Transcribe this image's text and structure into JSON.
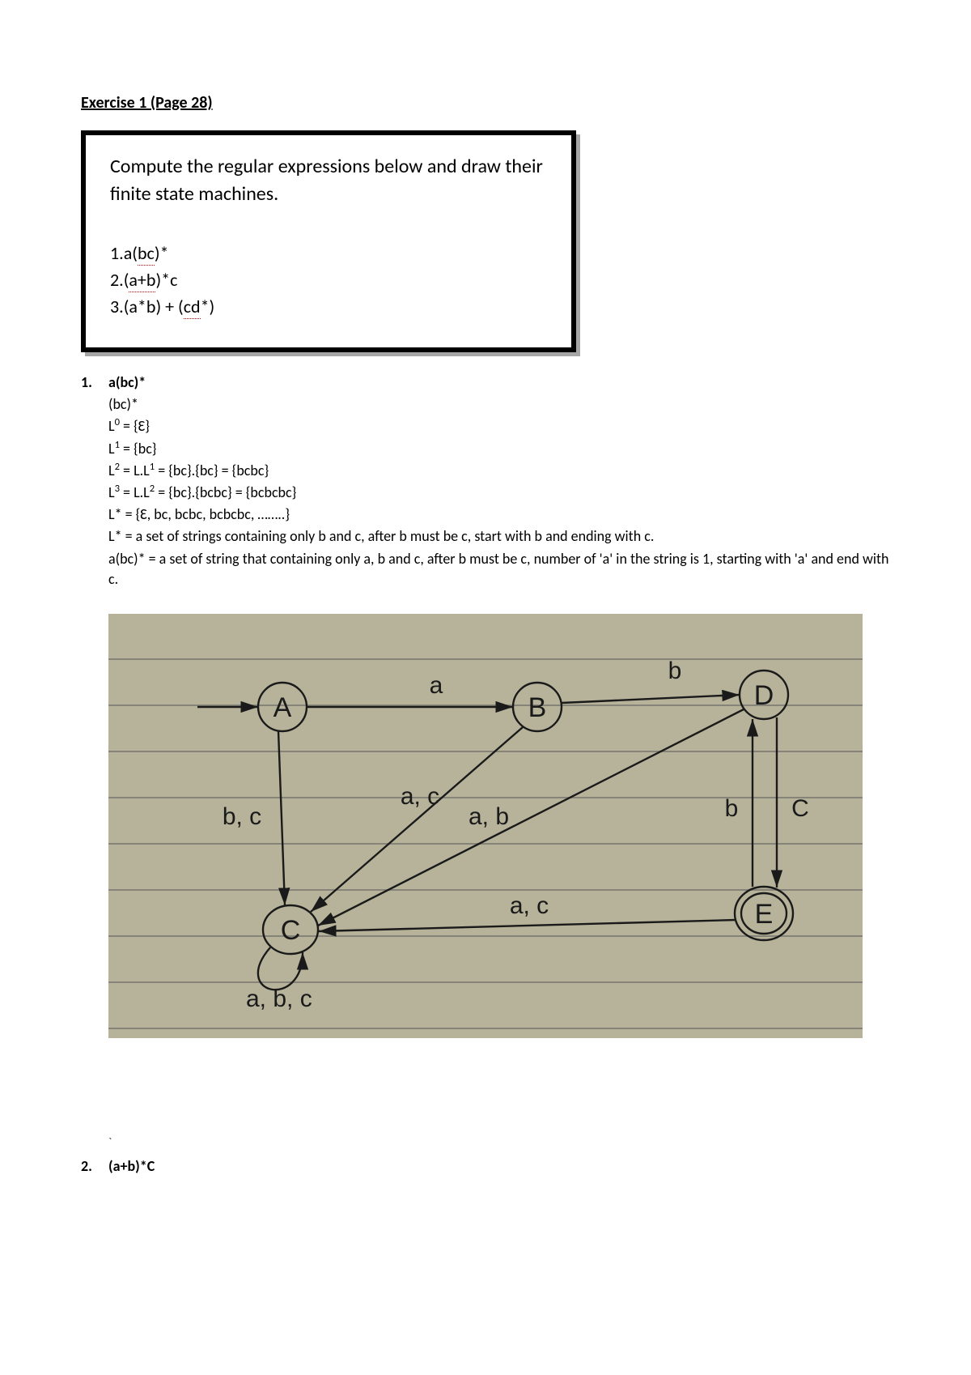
{
  "title": "Exercise 1 (Page 28)",
  "box": {
    "prompt": "Compute the regular expressions below and draw their finite state machines.",
    "items": {
      "n1": "1.",
      "e1a": "a(",
      "e1u": "bc",
      "e1b": ")*",
      "n2": "2.",
      "e2a": "(",
      "e2u": "a+b",
      "e2b": ")*c",
      "n3": "3.",
      "e3a": "(a*b) + (",
      "e3u": "cd",
      "e3b": "*)"
    }
  },
  "ans1": {
    "num": "1.",
    "head": "a(bc)*",
    "l1": "(bc)*",
    "l2a": "L",
    "l2sup": "0",
    "l2b": " = {Ɛ}",
    "l3a": "L",
    "l3sup": "1",
    "l3b": " = {bc}",
    "l4a": "L",
    "l4sup": "2",
    "l4mid": " = L.L",
    "l4sup2": "1",
    "l4b": " = {bc}.{bc} = {bcbc}",
    "l5a": "L",
    "l5sup": "3",
    "l5mid": " = L.L",
    "l5sup2": "2",
    "l5b": " = {bc}.{bcbc} = {bcbcbc}",
    "l6": "L* = {Ɛ, bc, bcbc, bcbcbc, ……..}",
    "l7": "L* = a set of strings containing only b and c, after b must be c, start with b and ending with c.",
    "l8": "a(bc)* = a set of string that containing only a, b and c, after b must be c, number of 'a' in the string is 1, starting with 'a' and end with c."
  },
  "diagram": {
    "A": "A",
    "B": "B",
    "C": "C",
    "D": "D",
    "E": "E",
    "t_a": "a",
    "t_b": "b",
    "t_c": "C",
    "t_bc": "b, c",
    "t_ac_1": "a, c",
    "t_ab": "a, b",
    "t_ac_2": "a, c",
    "t_abc": "a, b, c"
  },
  "backtick": "`",
  "ans2": {
    "num": "2.",
    "head": "(a+b)*C"
  }
}
